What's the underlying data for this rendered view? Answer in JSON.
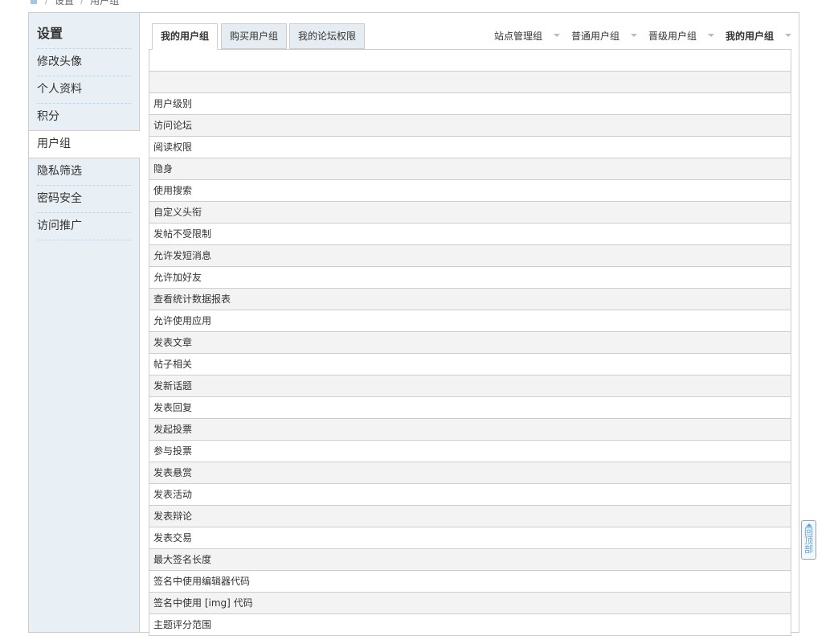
{
  "breadcrumb": {
    "home": "home-icon",
    "items": [
      "设置",
      "用户组"
    ]
  },
  "sidebar": {
    "title": "设置",
    "items": [
      {
        "label": "修改头像"
      },
      {
        "label": "个人资料"
      },
      {
        "label": "积分"
      },
      {
        "label": "用户组"
      },
      {
        "label": "隐私筛选"
      },
      {
        "label": "密码安全"
      },
      {
        "label": "访问推广"
      }
    ],
    "active": "用户组"
  },
  "tabs": [
    {
      "label": "我的用户组",
      "active": true
    },
    {
      "label": "购买用户组",
      "active": false
    },
    {
      "label": "我的论坛权限",
      "active": false
    }
  ],
  "group_switch": [
    {
      "label": "站点管理组"
    },
    {
      "label": "普通用户组"
    },
    {
      "label": "晋级用户组"
    },
    {
      "label": "我的用户组",
      "current": true
    }
  ],
  "permissions": {
    "rows": [
      "",
      "",
      "用户级别",
      "访问论坛",
      "阅读权限",
      "隐身",
      "使用搜索",
      "自定义头衔",
      "发帖不受限制",
      "允许发短消息",
      "允许加好友",
      "查看统计数据报表",
      "允许使用应用",
      "发表文章",
      "帖子相关",
      "发新话题",
      "发表回复",
      "发起投票",
      "参与投票",
      "发表悬赏",
      "发表活动",
      "发表辩论",
      "发表交易",
      "最大签名长度",
      "签名中使用编辑器代码",
      "签名中使用 [img] 代码",
      "主题评分范围"
    ]
  },
  "back_to_top": {
    "label": "回顶部"
  },
  "colors": {
    "sidebar_bg": "#e8eff5",
    "border": "#cdcdcd",
    "row_alt": "#f3f3f3",
    "tab_bg": "#e5edf2",
    "accent": "#6d9ed0"
  }
}
